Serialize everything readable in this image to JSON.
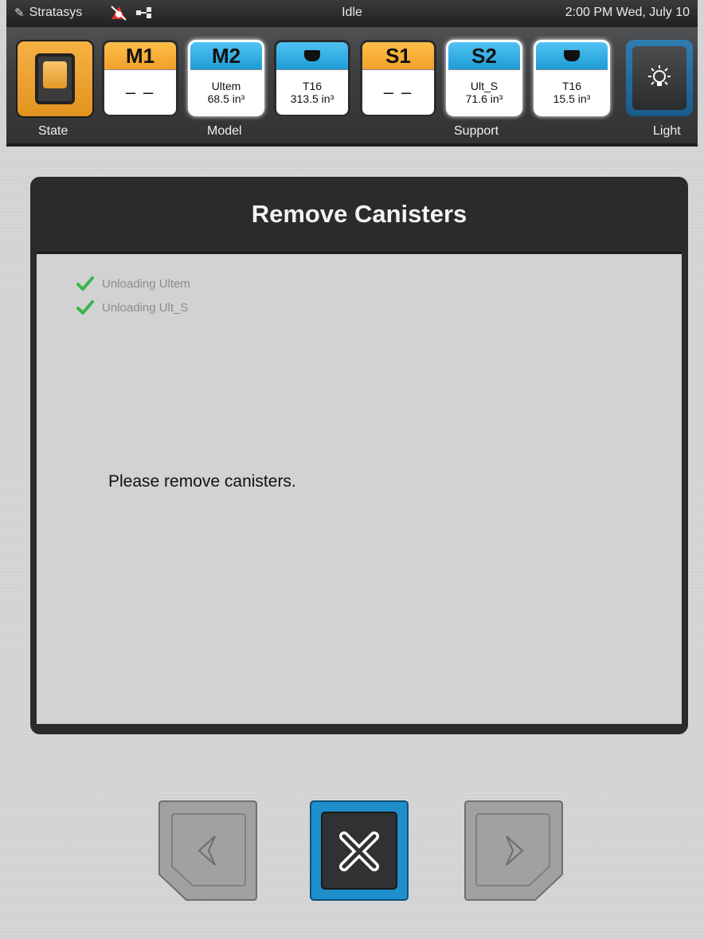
{
  "status_bar": {
    "brand": "Stratasys",
    "status": "Idle",
    "datetime": "2:00 PM Wed, July 10"
  },
  "toolbar": {
    "state_label": "State",
    "model_label": "Model",
    "support_label": "Support",
    "light_label": "Light",
    "bays": [
      {
        "id": "M1",
        "material": "– –",
        "volume": "",
        "color": "orange",
        "selected": false
      },
      {
        "id": "M2",
        "material": "Ultem",
        "volume": "68.5 in³",
        "color": "blue",
        "selected": true
      },
      {
        "id": "cartridge-model",
        "material": "T16",
        "volume": "313.5 in³",
        "color": "blue",
        "selected": false
      },
      {
        "id": "S1",
        "material": "– –",
        "volume": "",
        "color": "orange",
        "selected": false
      },
      {
        "id": "S2",
        "material": "Ult_S",
        "volume": "71.6 in³",
        "color": "blue",
        "selected": true
      },
      {
        "id": "cartridge-support",
        "material": "T16",
        "volume": "15.5 in³",
        "color": "blue",
        "selected": true
      }
    ]
  },
  "dialog": {
    "title": "Remove Canisters",
    "steps": [
      "Unloading Ultem",
      "Unloading Ult_S"
    ],
    "message": "Please remove canisters."
  },
  "colors": {
    "accent_orange": "#f0a02a",
    "accent_blue": "#1e9cd6",
    "check_green": "#3bb54a"
  }
}
